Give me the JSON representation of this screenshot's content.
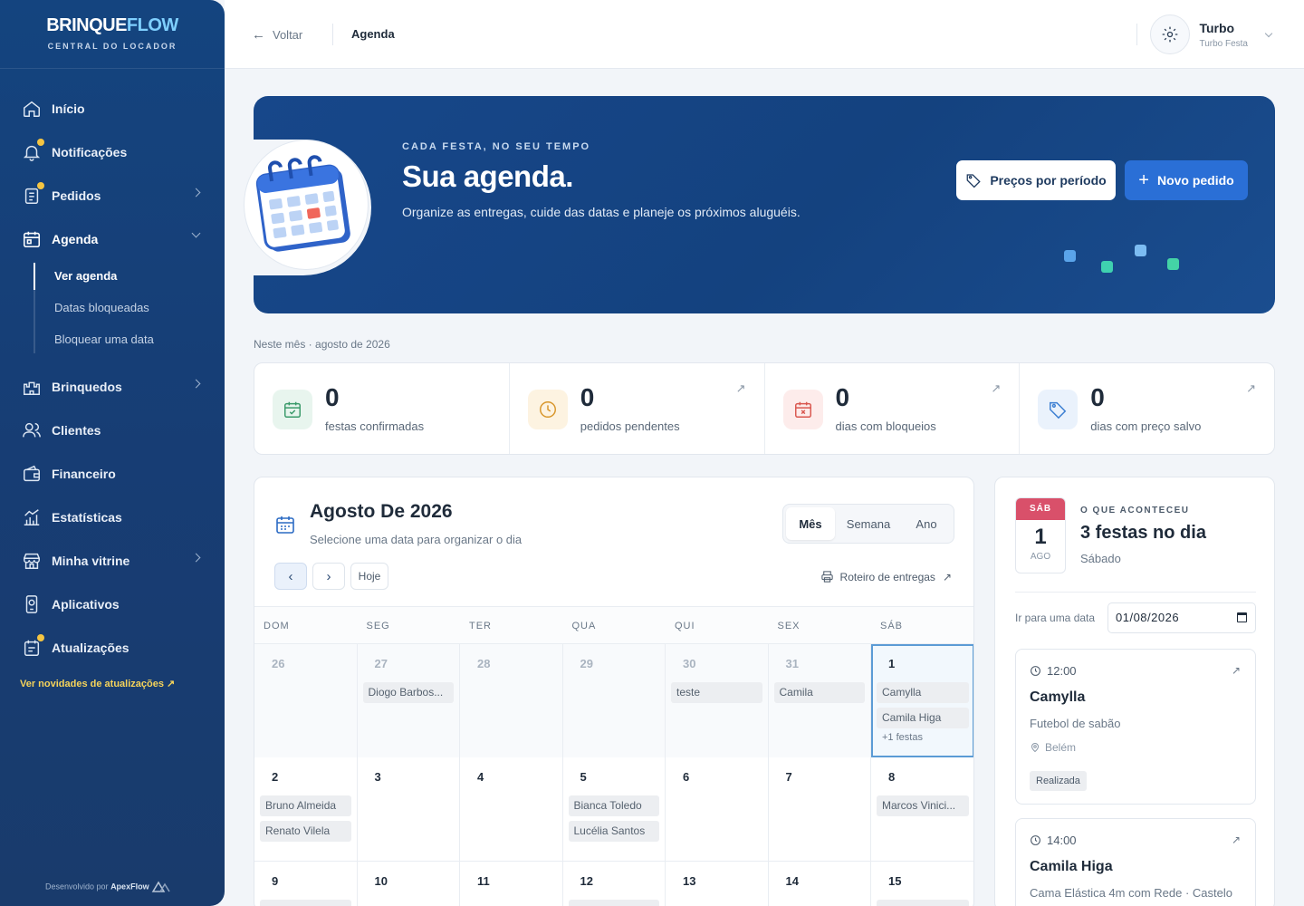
{
  "brand": {
    "name_a": "BRINQUE",
    "name_b": "FLOW",
    "tagline": "CENTRAL DO LOCADOR"
  },
  "sidebar": {
    "items": [
      {
        "label": "Início",
        "icon": "home-icon"
      },
      {
        "label": "Notificações",
        "icon": "bell-icon"
      },
      {
        "label": "Pedidos",
        "icon": "clipboard-icon"
      },
      {
        "label": "Agenda",
        "icon": "calendar-icon"
      },
      {
        "label": "Brinquedos",
        "icon": "castle-icon"
      },
      {
        "label": "Clientes",
        "icon": "users-icon"
      },
      {
        "label": "Financeiro",
        "icon": "wallet-icon"
      },
      {
        "label": "Estatísticas",
        "icon": "chart-icon"
      },
      {
        "label": "Minha vitrine",
        "icon": "store-icon"
      },
      {
        "label": "Aplicativos",
        "icon": "phone-icon"
      },
      {
        "label": "Atualizações",
        "icon": "update-icon"
      }
    ],
    "subitems": [
      "Ver agenda",
      "Datas bloqueadas",
      "Bloquear uma data"
    ],
    "updates_link": "Ver novidades de atualizações ↗",
    "dev_prefix": "Desenvolvido por",
    "dev_name": "ApexFlow"
  },
  "topbar": {
    "back": "Voltar",
    "crumb": "Agenda",
    "user_name": "Turbo",
    "user_sub": "Turbo Festa"
  },
  "hero": {
    "eyebrow": "CADA FESTA, NO SEU TEMPO",
    "title": "Sua agenda.",
    "desc": "Organize as entregas, cuide das datas e planeje os próximos aluguéis.",
    "btn_prices": "Preços por período",
    "btn_new": "Novo pedido"
  },
  "month_label": "Neste mês · agosto de 2026",
  "stats": [
    {
      "value": "0",
      "label": "festas confirmadas",
      "color": "#e8f5ee"
    },
    {
      "value": "0",
      "label": "pedidos pendentes",
      "color": "#fdf3e1"
    },
    {
      "value": "0",
      "label": "dias com bloqueios",
      "color": "#fdeceb"
    },
    {
      "value": "0",
      "label": "dias com preço salvo",
      "color": "#eaf2fc"
    }
  ],
  "calendar": {
    "title": "Agosto De 2026",
    "subtitle": "Selecione uma data para organizar o dia",
    "views": [
      "Mês",
      "Semana",
      "Ano"
    ],
    "today": "Hoje",
    "roteiro": "Roteiro de entregas",
    "dow": [
      "DOM",
      "SEG",
      "TER",
      "QUA",
      "QUI",
      "SEX",
      "SÁB"
    ],
    "weeks": [
      [
        {
          "n": "26",
          "muted": true,
          "ev": []
        },
        {
          "n": "27",
          "muted": true,
          "ev": [
            "Diogo Barbos..."
          ]
        },
        {
          "n": "28",
          "muted": true,
          "ev": []
        },
        {
          "n": "29",
          "muted": true,
          "ev": []
        },
        {
          "n": "30",
          "muted": true,
          "ev": [
            "teste"
          ]
        },
        {
          "n": "31",
          "muted": true,
          "ev": [
            "Camila"
          ]
        },
        {
          "n": "1",
          "muted": false,
          "sel": true,
          "ev": [
            "Camylla",
            "Camila Higa"
          ],
          "more": "+1 festas"
        }
      ],
      [
        {
          "n": "2",
          "ev": [
            "Bruno Almeida",
            "Renato Vilela"
          ]
        },
        {
          "n": "3",
          "ev": []
        },
        {
          "n": "4",
          "ev": []
        },
        {
          "n": "5",
          "ev": [
            "Bianca Toledo",
            "Lucélia Santos"
          ]
        },
        {
          "n": "6",
          "ev": []
        },
        {
          "n": "7",
          "ev": []
        },
        {
          "n": "8",
          "ev": [
            "Marcos Vinici..."
          ]
        }
      ],
      [
        {
          "n": "9",
          "ev": [
            ""
          ]
        },
        {
          "n": "10",
          "ev": []
        },
        {
          "n": "11",
          "ev": []
        },
        {
          "n": "12",
          "ev": [
            ""
          ]
        },
        {
          "n": "13",
          "ev": []
        },
        {
          "n": "14",
          "ev": []
        },
        {
          "n": "15",
          "ev": [
            ""
          ]
        }
      ]
    ]
  },
  "side": {
    "dow": "SÁB",
    "day": "1",
    "mon": "AGO",
    "eyebrow": "O QUE ACONTECEU",
    "title": "3 festas no dia",
    "sub": "Sábado",
    "goto_label": "Ir para uma data",
    "goto_value": "01/08/2026",
    "events": [
      {
        "time": "12:00",
        "name": "Camylla",
        "toy": "Futebol de sabão",
        "loc": "Belém",
        "status": "Realizada"
      },
      {
        "time": "14:00",
        "name": "Camila Higa",
        "toy": "Cama Elástica 4m com Rede · Castelo",
        "loc": "",
        "status": ""
      }
    ]
  }
}
